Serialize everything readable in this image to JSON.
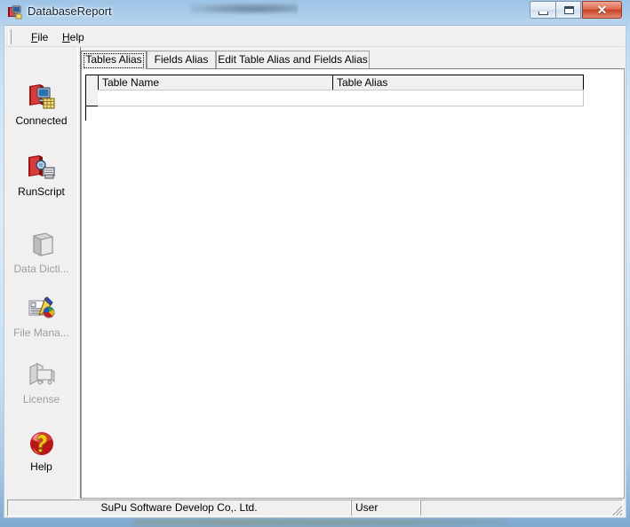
{
  "window": {
    "title": "DatabaseReport",
    "icon": "database-report-app-icon",
    "controls": {
      "minimize": "Minimize",
      "maximize": "Maximize",
      "close": "Close",
      "close_glyph": "✕"
    }
  },
  "menubar": {
    "items": [
      {
        "label": "File",
        "accel": "F",
        "name": "menu-file"
      },
      {
        "label": "Help",
        "accel": "H",
        "name": "menu-help"
      }
    ]
  },
  "sidebar": {
    "items": [
      {
        "label": "Connected",
        "icon": "connected-icon",
        "enabled": true
      },
      {
        "label": "RunScript",
        "icon": "run-script-icon",
        "enabled": true
      },
      {
        "label": "Data Dicti...",
        "icon": "data-dictionary-icon",
        "enabled": false
      },
      {
        "label": "File Mana...",
        "icon": "file-manage-icon",
        "enabled": false
      },
      {
        "label": "License",
        "icon": "license-icon",
        "enabled": false
      },
      {
        "label": "Help",
        "icon": "help-ball-icon",
        "enabled": true
      }
    ]
  },
  "main": {
    "tabs": [
      {
        "label": "Tables Alias",
        "active": true
      },
      {
        "label": "Fields Alias",
        "active": false
      },
      {
        "label": "Edit Table Alias and Fields Alias",
        "active": false
      }
    ],
    "grid": {
      "columns": [
        "Table Name",
        "Table Alias"
      ],
      "rows": [
        {
          "indicator": "",
          "cells": [
            "",
            ""
          ]
        }
      ]
    }
  },
  "statusbar": {
    "company": "SuPu Software Develop Co,. Ltd.",
    "user": "User",
    "extra": "",
    "grip": "resize-grip"
  },
  "colors": {
    "frame_glass": "#cfe5f6",
    "client_bg": "#f0f0f0",
    "panel_bg": "#ffffff",
    "close_button": "#c63f22",
    "icon_red": "#c01f1f",
    "disabled_text": "#9d9d9d"
  }
}
